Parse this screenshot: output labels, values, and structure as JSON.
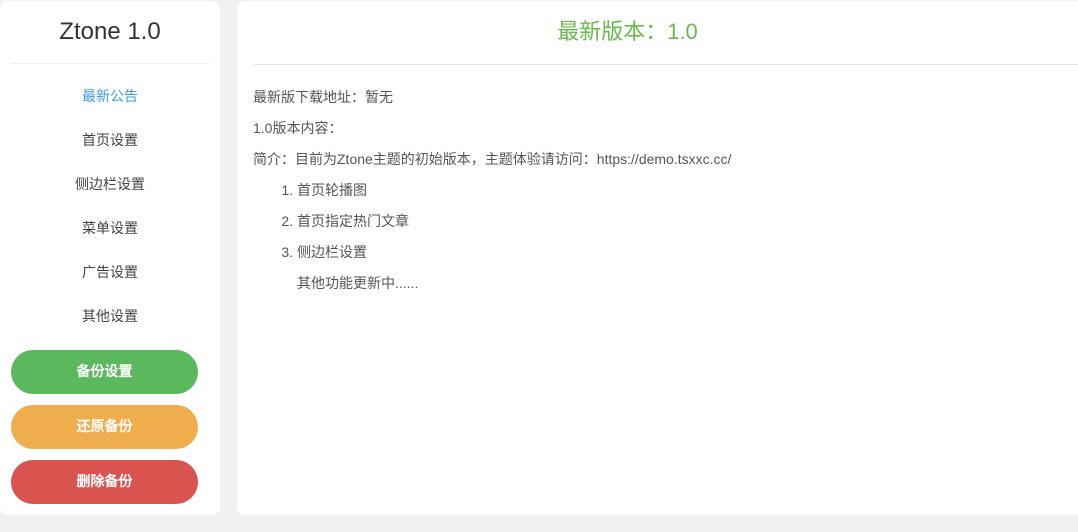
{
  "sidebar": {
    "brand": "Ztone 1.0",
    "items": [
      {
        "label": "最新公告",
        "active": true
      },
      {
        "label": "首页设置",
        "active": false
      },
      {
        "label": "侧边栏设置",
        "active": false
      },
      {
        "label": "菜单设置",
        "active": false
      },
      {
        "label": "广告设置",
        "active": false
      },
      {
        "label": "其他设置",
        "active": false
      }
    ],
    "buttons": {
      "backup": "备份设置",
      "restore": "还原备份",
      "delete": "删除备份"
    }
  },
  "main": {
    "title": "最新版本：1.0",
    "download": "最新版下载地址：暂无",
    "version_content": "1.0版本内容：",
    "intro": "简介：目前为Ztone主题的初始版本，主题体验请访问：https://demo.tsxxc.cc/",
    "features": [
      "首页轮播图",
      "首页指定热门文章",
      "侧边栏设置"
    ],
    "more": "其他功能更新中......"
  },
  "colors": {
    "accent_green": "#68b94a",
    "active_blue": "#3c9be6",
    "button_green": "#5cb85c",
    "button_orange": "#efad4d",
    "button_red": "#d9534f"
  }
}
